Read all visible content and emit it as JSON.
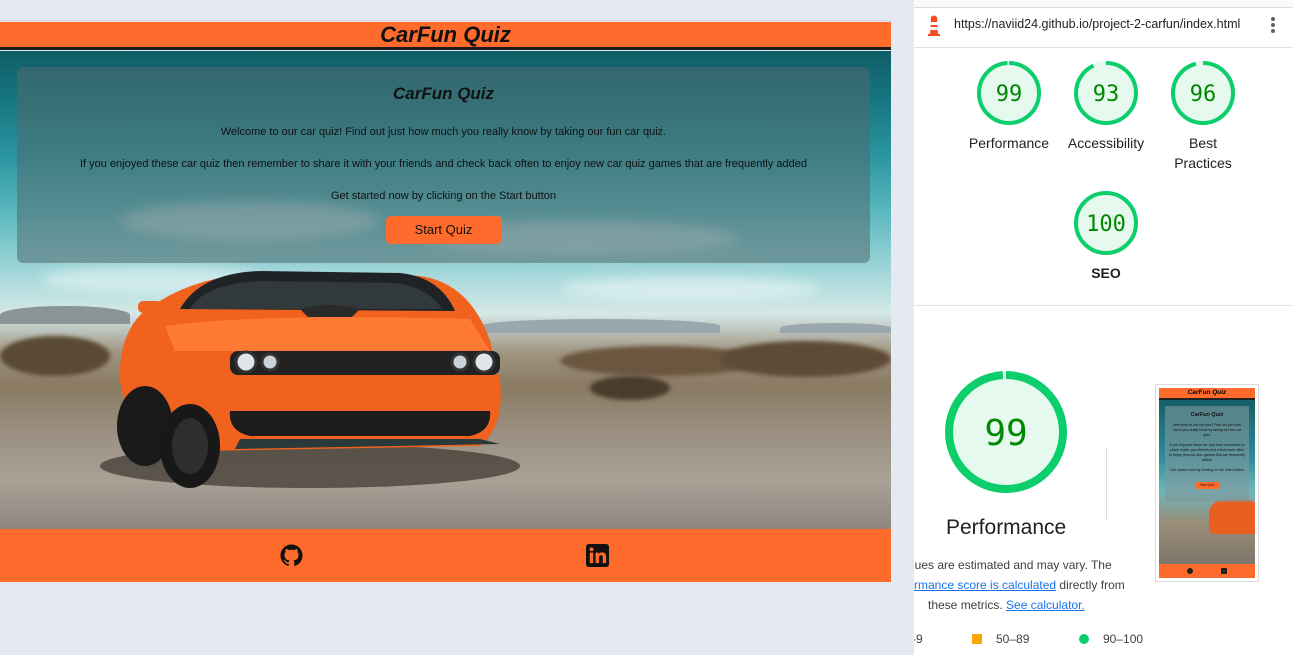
{
  "site": {
    "header_title": "CarFun Quiz",
    "intro": {
      "title": "CarFun Quiz",
      "paragraph1": "Welcome to our car quiz! Find out just how much you really know by taking our fun car quiz.",
      "paragraph2": "If you enjoyed these car quiz then remember to share it with your friends and check back often to enjoy new car quiz games that are frequently added",
      "paragraph3": "Get started now by clicking on the Start button",
      "start_button": "Start Quiz"
    },
    "footer": {
      "icons": [
        "github-icon",
        "linkedin-icon"
      ]
    },
    "colors": {
      "brand_orange": "#ff6b2c",
      "text_dark": "#111111"
    }
  },
  "lighthouse": {
    "url": "https://naviid24.github.io/project-2-carfun/index.html",
    "scores": [
      {
        "label": "Performance",
        "score": "99",
        "value": 99
      },
      {
        "label": "Accessibility",
        "score": "93",
        "value": 93
      },
      {
        "label": "Best Practices",
        "score": "96",
        "value": 96
      },
      {
        "label": "SEO",
        "score": "100",
        "value": 100
      }
    ],
    "big_score": {
      "score": "99",
      "value": 99,
      "title": "Performance"
    },
    "note": {
      "line1": "lues are estimated and may vary. The",
      "line2_link": "rmance score is calculated",
      "line2_rest": " directly from",
      "line3": "these metrics. ",
      "line3_link": "See calculator."
    },
    "thumbnail": {
      "header": "CarFun Quiz",
      "title": "CarFun Quiz",
      "text1": "Welcome to our car quiz! Find out just how much you really know by taking our fun car quiz.",
      "text2": "If you enjoyed these car quiz then remember to share it with your friends and check back often to enjoy new car quiz games that are frequently added",
      "text3": "Get started now by clicking on the Start button",
      "button": "Start Quiz"
    },
    "legend": {
      "fail": "-9",
      "average": "50–89",
      "pass": "90–100"
    },
    "colors": {
      "pass": "#0cce6b",
      "pass_text": "#008800",
      "pass_bg": "#e6f9ef",
      "average": "#ffa400"
    }
  }
}
